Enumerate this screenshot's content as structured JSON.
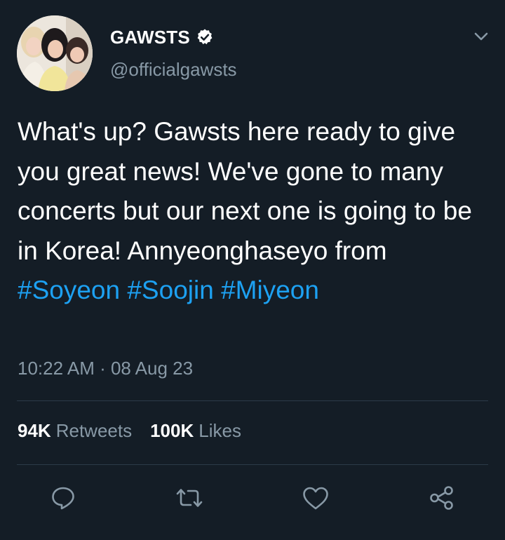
{
  "account": {
    "display_name": "GAWSTS",
    "handle": "@officialgawsts",
    "verified": true
  },
  "tweet": {
    "text_segments": [
      "What's up? Gawsts here ready to give you great news! We've gone to many concerts but our next one is going to be in Korea! Annyeonghaseyo from "
    ],
    "hashtags": [
      "#Soyeon",
      "#Soojin",
      "#Miyeon"
    ],
    "timestamp": "10:22 AM · 08 Aug 23"
  },
  "stats": {
    "retweets_count": "94K",
    "retweets_label": "Retweets",
    "likes_count": "100K",
    "likes_label": "Likes"
  },
  "actions": {
    "reply_icon": "reply-icon",
    "retweet_icon": "retweet-icon",
    "like_icon": "heart-icon",
    "share_icon": "share-icon"
  },
  "colors": {
    "background": "#141d26",
    "text": "#ffffff",
    "secondary_text": "#8899a6",
    "accent": "#1da1f2",
    "divider": "#2c3a48"
  }
}
